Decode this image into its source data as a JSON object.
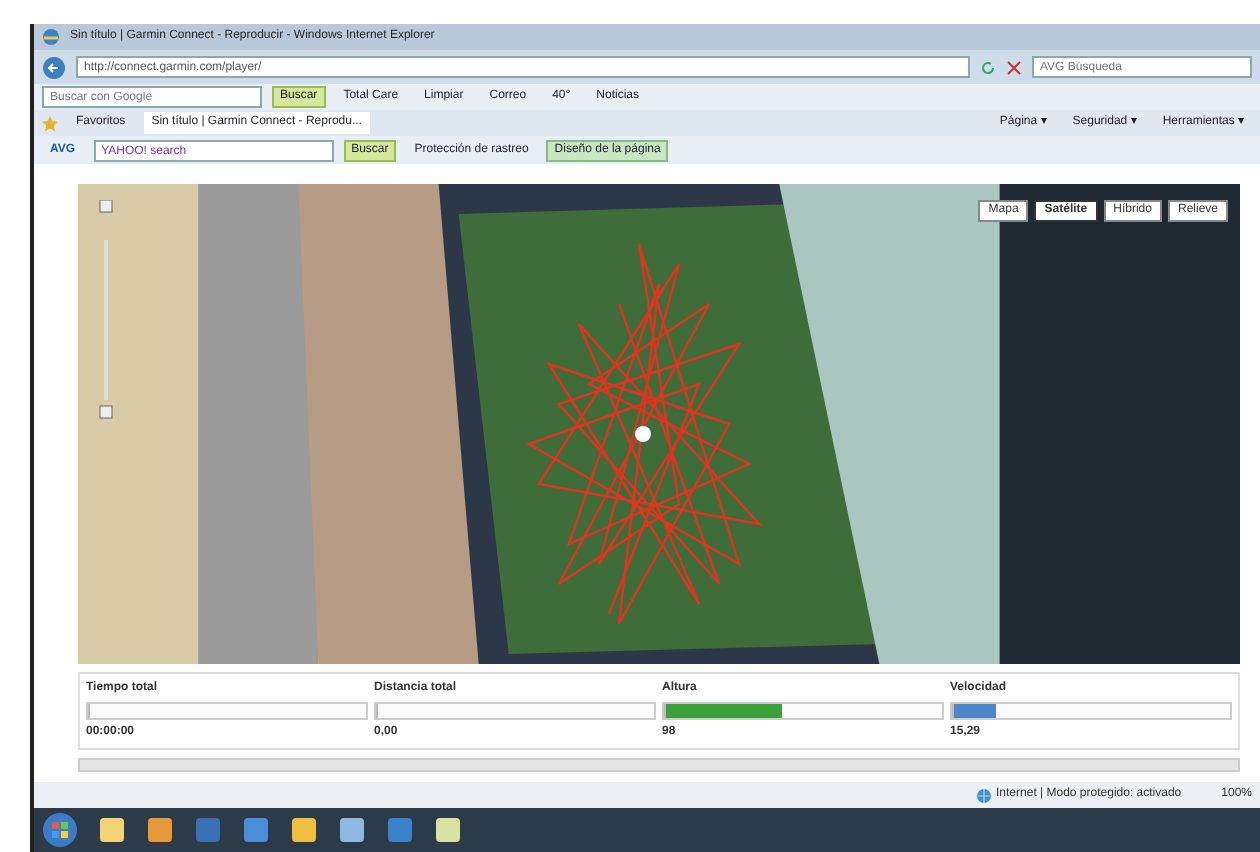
{
  "window": {
    "title": "Sin título | Garmin Connect - Reproducir - Windows Internet Explorer"
  },
  "address_bar": {
    "url": "http://connect.garmin.com/player/",
    "search_placeholder": "AVG Búsqueda"
  },
  "google_toolbar": {
    "search_placeholder": "Buscar con Google",
    "buttons": [
      {
        "label": "Buscar",
        "kind": "primary"
      },
      {
        "label": "Total Care",
        "kind": "plain"
      },
      {
        "label": "Limpiar",
        "kind": "plain"
      },
      {
        "label": "Correo",
        "kind": "plain"
      },
      {
        "label": "40°",
        "kind": "plain"
      },
      {
        "label": "Noticias",
        "kind": "plain"
      }
    ]
  },
  "favorites_bar": {
    "label": "Favoritos",
    "tab": "Sin título | Garmin Connect - Reprodu...",
    "menus": [
      "Página ▾",
      "Seguridad ▾",
      "Herramientas ▾"
    ]
  },
  "avg_toolbar": {
    "logo": "AVG",
    "search_text": "YAHOO! search",
    "buttons": [
      {
        "label": "Buscar",
        "kind": "primary"
      },
      {
        "label": "Protección de rastreo",
        "kind": "plain"
      },
      {
        "label": "Diseño de la página",
        "kind": "accent"
      }
    ]
  },
  "map": {
    "types": [
      {
        "label": "Mapa",
        "selected": false
      },
      {
        "label": "Satélite",
        "selected": true
      },
      {
        "label": "Híbrido",
        "selected": false
      },
      {
        "label": "Relieve",
        "selected": false
      }
    ]
  },
  "stats": [
    {
      "label": "Tiempo total",
      "value": "00:00:00",
      "level": 0
    },
    {
      "label": "Distancia total",
      "value": "0,00",
      "level": 0
    },
    {
      "label": "Altura",
      "value": "98",
      "level": 0.42,
      "color": "#3aa13a"
    },
    {
      "label": "Velocidad",
      "value": "15,29",
      "level": 0.15,
      "color": "#4a86c8"
    }
  ],
  "status_bar": {
    "zone": "Internet | Modo protegido: activado",
    "zoom": "100%"
  }
}
